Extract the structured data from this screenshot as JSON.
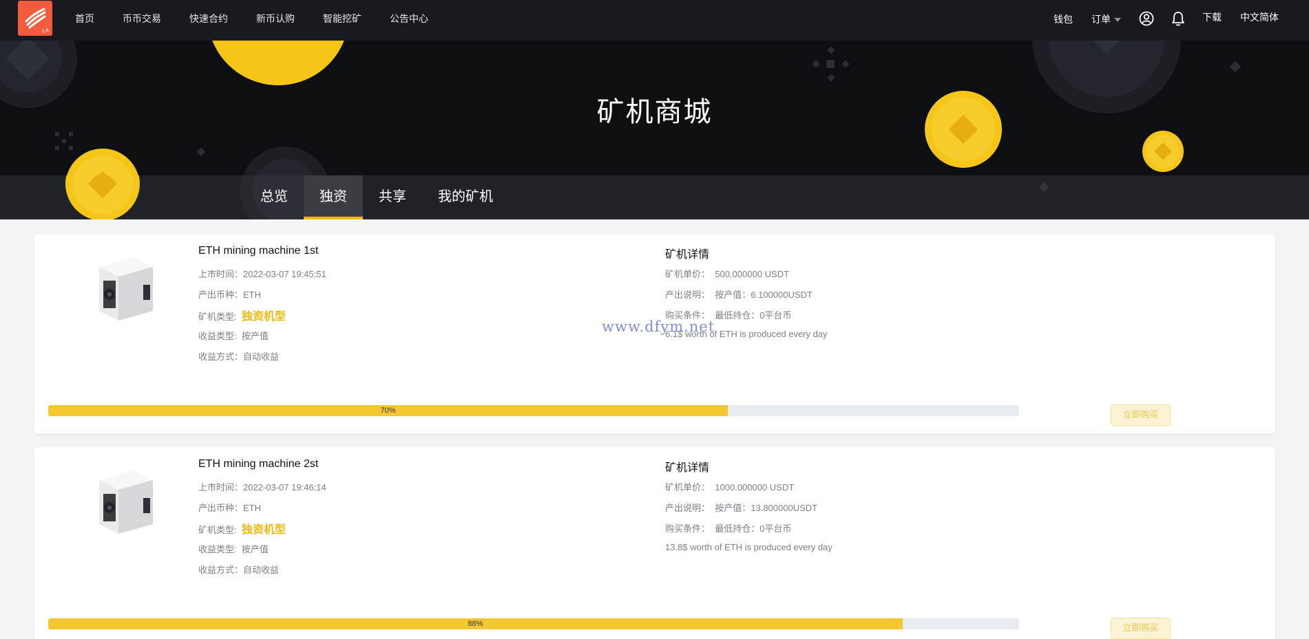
{
  "nav": {
    "items": [
      {
        "label": "首页",
        "name": "nav-home"
      },
      {
        "label": "币币交易",
        "name": "nav-spot-trading"
      },
      {
        "label": "快速合约",
        "name": "nav-quick-contract"
      },
      {
        "label": "新币认购",
        "name": "nav-new-coin-subscription"
      },
      {
        "label": "智能挖矿",
        "name": "nav-smart-mining"
      },
      {
        "label": "公告中心",
        "name": "nav-announcements"
      }
    ],
    "wallet": "钱包",
    "orders": "订单",
    "download": "下载",
    "language": "中文简体",
    "logo_text": "LA"
  },
  "banner": {
    "title": "矿机商城"
  },
  "tabs": [
    {
      "label": "总览",
      "active": false
    },
    {
      "label": "独资",
      "active": true
    },
    {
      "label": "共享",
      "active": false
    },
    {
      "label": "我的矿机",
      "active": false
    }
  ],
  "labels": {
    "listed_time": "上市时间：",
    "output_coin": "产出币种：",
    "miner_type": "矿机类型:",
    "revenue_type": "收益类型:",
    "revenue_method": "收益方式：",
    "details_title": "矿机详情",
    "unit_price": "矿机单价：",
    "output_desc": "产出说明：",
    "purchase_cond": "购买条件：",
    "buy_button": "立即购买"
  },
  "machines": [
    {
      "name": "ETH mining machine 1st",
      "listed_time": "2022-03-07 19:45:51",
      "output_coin": "ETH",
      "miner_type": "独资机型",
      "revenue_type": "按产值",
      "revenue_method": "自动收益",
      "unit_price": "500.000000 USDT",
      "output_desc": "按产值：6.100000USDT",
      "purchase_cond": "最低持仓：0平台币",
      "daily_note": "6.1$ worth of ETH is produced every day",
      "progress": 0.7,
      "progress_label": "70%"
    },
    {
      "name": "ETH mining machine 2st",
      "listed_time": "2022-03-07 19:46:14",
      "output_coin": "ETH",
      "miner_type": "独资机型",
      "revenue_type": "按产值",
      "revenue_method": "自动收益",
      "unit_price": "1000.000000 USDT",
      "output_desc": "按产值：13.800000USDT",
      "purchase_cond": "最低持仓：0平台币",
      "daily_note": "13.8$ worth of ETH is produced every day",
      "progress": 0.88,
      "progress_label": "88%"
    }
  ],
  "watermark": "www.dfym.net",
  "colors": {
    "accent": "#f0b90b",
    "progress_fill": "#f4c630",
    "nav_bg": "#181a20",
    "logo_bg": "#f45a3c"
  }
}
